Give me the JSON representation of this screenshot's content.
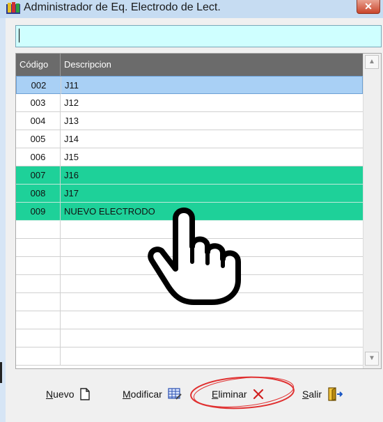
{
  "window": {
    "title": "Administrador de Eq. Electrodo de Lect.",
    "close_label": "✕"
  },
  "search": {
    "value": ""
  },
  "table": {
    "columns": [
      "Código",
      "Descripcion"
    ],
    "rows": [
      {
        "code": "002",
        "desc": "J11"
      },
      {
        "code": "003",
        "desc": "J12"
      },
      {
        "code": "004",
        "desc": "J13"
      },
      {
        "code": "005",
        "desc": "J14"
      },
      {
        "code": "006",
        "desc": "J15"
      },
      {
        "code": "007",
        "desc": "J16"
      },
      {
        "code": "008",
        "desc": "J17"
      },
      {
        "code": "009",
        "desc": "NUEVO ELECTRODO"
      }
    ]
  },
  "toolbar": {
    "nuevo": {
      "first": "N",
      "rest": "uevo"
    },
    "modificar": {
      "first": "M",
      "rest": "odificar"
    },
    "eliminar": {
      "first": "E",
      "rest": "liminar"
    },
    "salir": {
      "first": "S",
      "rest": "alir"
    }
  },
  "colors": {
    "selected_row": "#a9d0f5",
    "highlight_row": "#1ed199",
    "search_bg": "#cfffff",
    "header_bg": "#6b6b6b",
    "annotation": "#e03030"
  },
  "icons": [
    "app-icon",
    "close-icon",
    "new-document-icon",
    "edit-grid-icon",
    "delete-x-icon",
    "exit-door-icon",
    "pointing-hand-cursor",
    "scroll-up-icon",
    "scroll-down-icon"
  ]
}
